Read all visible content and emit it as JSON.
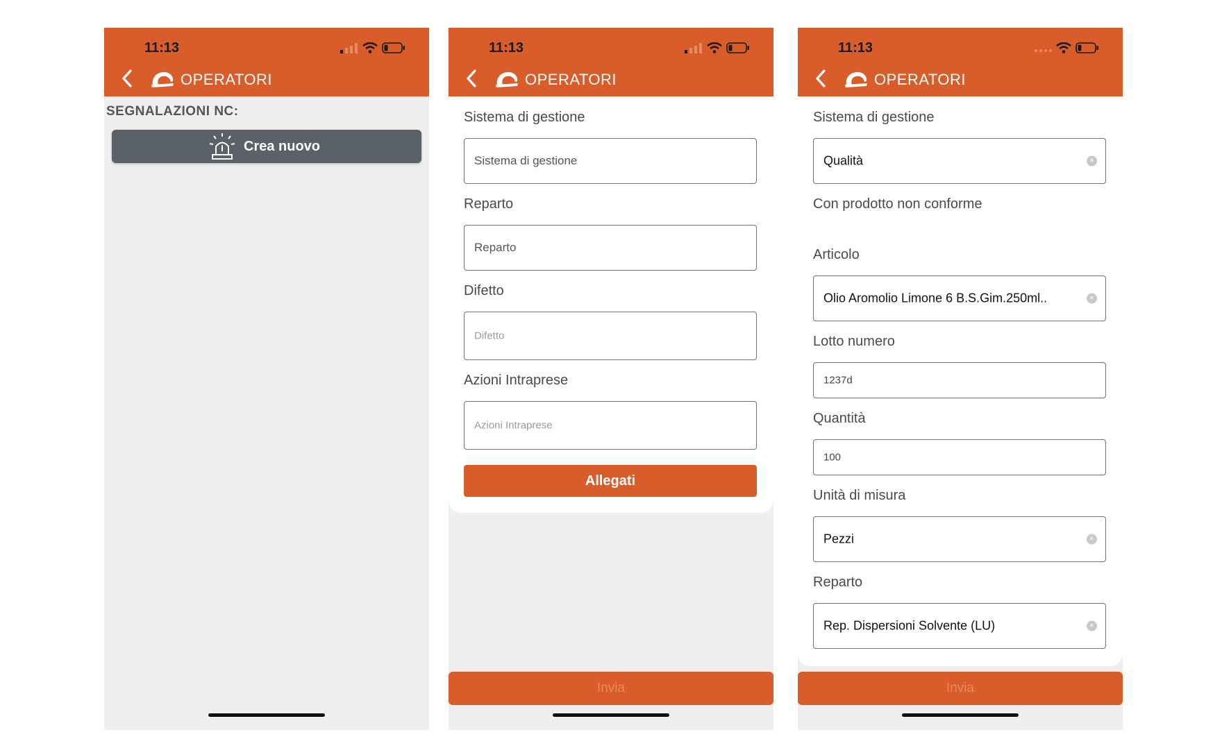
{
  "status_time": "11:13",
  "app_title": "OPERATORI",
  "colors": {
    "accent": "#d95d2b",
    "gray_button": "#5b6168",
    "background": "#efefef"
  },
  "screen1": {
    "section_title": "SEGNALAZIONI NC:",
    "create_label": "Crea nuovo"
  },
  "screen2": {
    "fields": [
      {
        "label": "Sistema di gestione",
        "placeholder": "Sistema di gestione"
      },
      {
        "label": "Reparto",
        "placeholder": "Reparto"
      },
      {
        "label": "Difetto",
        "placeholder": "Difetto"
      },
      {
        "label": "Azioni Intraprese",
        "placeholder": "Azioni Intraprese"
      }
    ],
    "attachments_label": "Allegati",
    "submit_label": "Invia"
  },
  "screen3": {
    "sistema_label": "Sistema di gestione",
    "sistema_value": "Qualità",
    "nonconforme_label": "Con prodotto non conforme",
    "nonconforme_checked": true,
    "articolo_label": "Articolo",
    "articolo_value": "Olio Aromolio Limone 6 B.S.Gim.250ml..",
    "lotto_label": "Lotto numero",
    "lotto_value": "1237d",
    "quantita_label": "Quantità",
    "quantita_value": "100",
    "unita_label": "Unità di misura",
    "unita_value": "Pezzi",
    "reparto_label": "Reparto",
    "reparto_value": "Rep. Dispersioni Solvente (LU)",
    "submit_label": "Invia"
  }
}
